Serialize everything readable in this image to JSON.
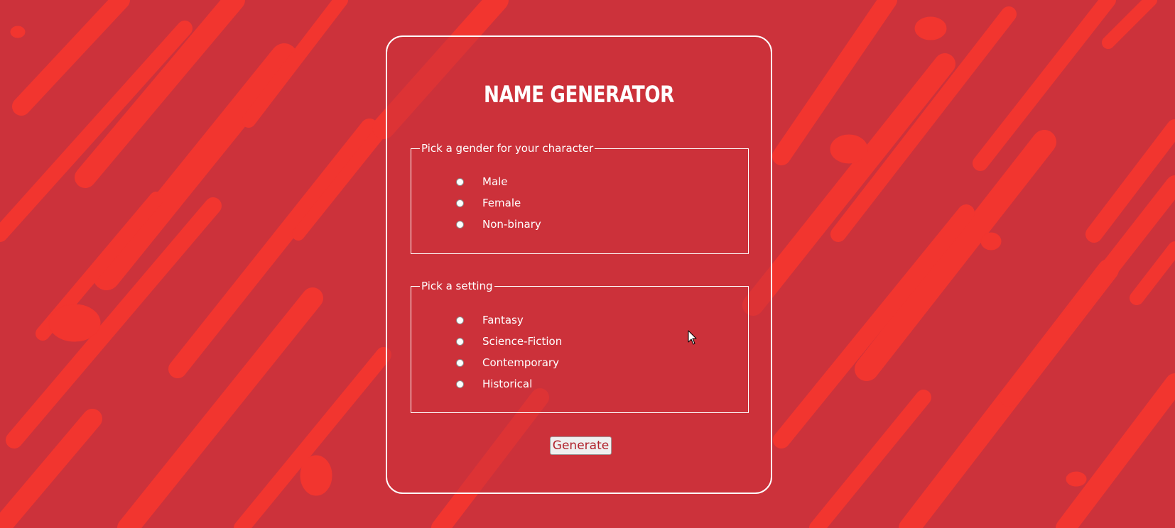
{
  "title": "NAME GENERATOR",
  "gender": {
    "legend": "Pick a gender for your character",
    "options": [
      "Male",
      "Female",
      "Non-binary"
    ]
  },
  "setting": {
    "legend": "Pick a setting",
    "options": [
      "Fantasy",
      "Science-Fiction",
      "Contemporary",
      "Historical"
    ]
  },
  "generate_label": "Generate",
  "colors": {
    "background": "#cc323b",
    "streaks": "#f2352f",
    "text": "#ffffff",
    "button_text": "#b0222c"
  }
}
